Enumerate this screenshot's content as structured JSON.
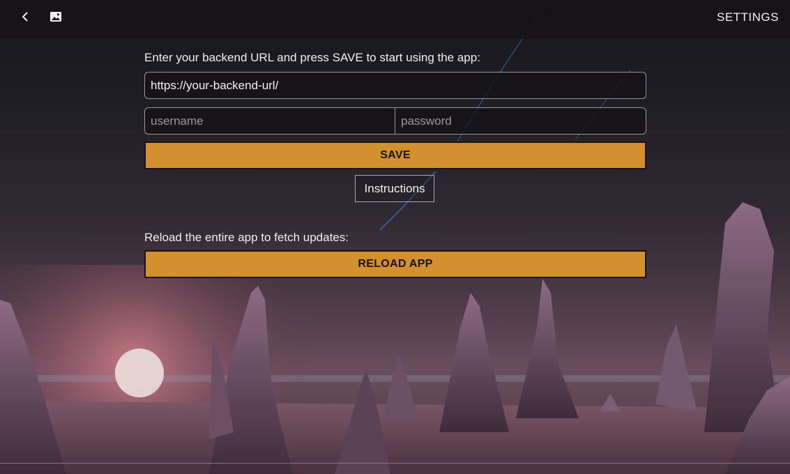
{
  "header": {
    "back_icon": "chevron-left-icon",
    "image_icon": "image-icon",
    "title": "SETTINGS"
  },
  "backend": {
    "label": "Enter your backend URL and press SAVE to start using the app:",
    "url_value": "https://your-backend-url/",
    "username_placeholder": "username",
    "password_placeholder": "password",
    "save_label": "SAVE",
    "instructions_label": "Instructions"
  },
  "reload": {
    "label": "Reload the entire app to fetch updates:",
    "button_label": "RELOAD APP"
  },
  "colors": {
    "accent": "#d4902f",
    "topbar": "#161418"
  }
}
